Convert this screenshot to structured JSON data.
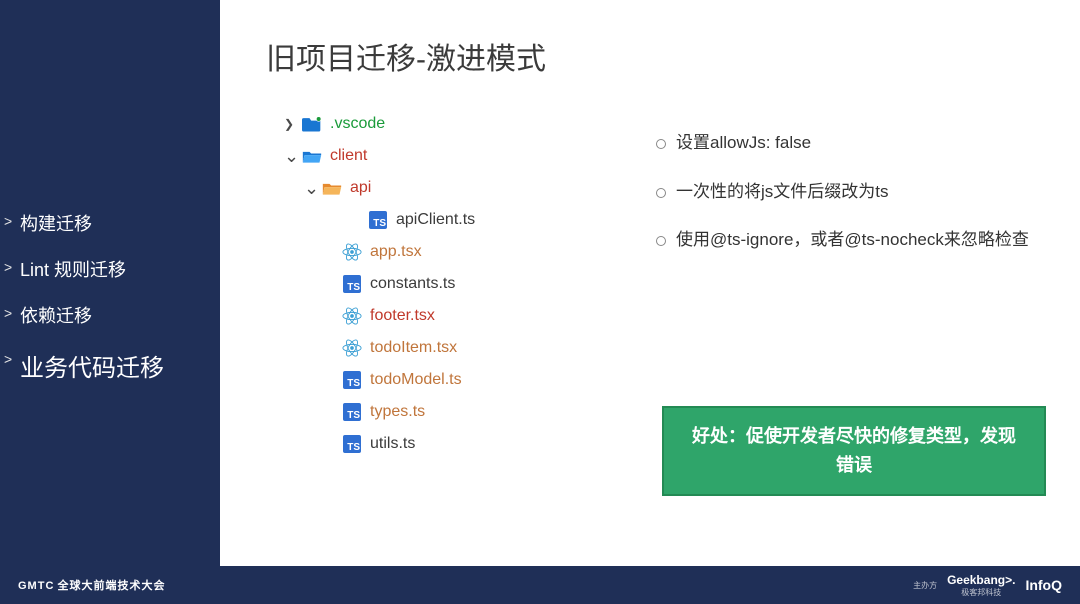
{
  "sidebar": {
    "items": [
      {
        "label": "构建迁移",
        "active": false
      },
      {
        "label": "Lint 规则迁移",
        "active": false
      },
      {
        "label": "依赖迁移",
        "active": false
      },
      {
        "label": "业务代码迁移",
        "active": true
      }
    ]
  },
  "title": "旧项目迁移-激进模式",
  "filetree": [
    {
      "depth": 0,
      "chevron": "right",
      "icon": "folder-blue-dot",
      "name": ".vscode",
      "nameClass": "name-green"
    },
    {
      "depth": 0,
      "chevron": "down",
      "icon": "folder-blue-open",
      "name": "client",
      "nameClass": "name-open"
    },
    {
      "depth": 1,
      "chevron": "down",
      "icon": "folder-orange-open",
      "name": "api",
      "nameClass": "name-open"
    },
    {
      "depth": 3,
      "chevron": "",
      "icon": "ts",
      "name": "apiClient.ts",
      "nameClass": "name-norm"
    },
    {
      "depth": 2,
      "chevron": "",
      "icon": "react",
      "name": "app.tsx",
      "nameClass": "name-mod"
    },
    {
      "depth": 2,
      "chevron": "",
      "icon": "ts",
      "name": "constants.ts",
      "nameClass": "name-norm"
    },
    {
      "depth": 2,
      "chevron": "",
      "icon": "react",
      "name": "footer.tsx",
      "nameClass": "name-open"
    },
    {
      "depth": 2,
      "chevron": "",
      "icon": "react",
      "name": "todoItem.tsx",
      "nameClass": "name-mod"
    },
    {
      "depth": 2,
      "chevron": "",
      "icon": "ts",
      "name": "todoModel.ts",
      "nameClass": "name-mod"
    },
    {
      "depth": 2,
      "chevron": "",
      "icon": "ts",
      "name": "types.ts",
      "nameClass": "name-mod"
    },
    {
      "depth": 2,
      "chevron": "",
      "icon": "ts",
      "name": "utils.ts",
      "nameClass": "name-norm"
    }
  ],
  "bullets": [
    "设置allowJs: false",
    "一次性的将js文件后缀改为ts",
    "使用@ts-ignore，或者@ts-nocheck来忽略检查"
  ],
  "callout": "好处：促使开发者尽快的修复类型，发现错误",
  "footer": {
    "left": "GMTC",
    "leftSub": "全球大前端技术大会",
    "hostLabel": "主办方",
    "geek": "Geekbang>.",
    "geekSub": "极客邦科技",
    "infoq": "InfoQ"
  }
}
